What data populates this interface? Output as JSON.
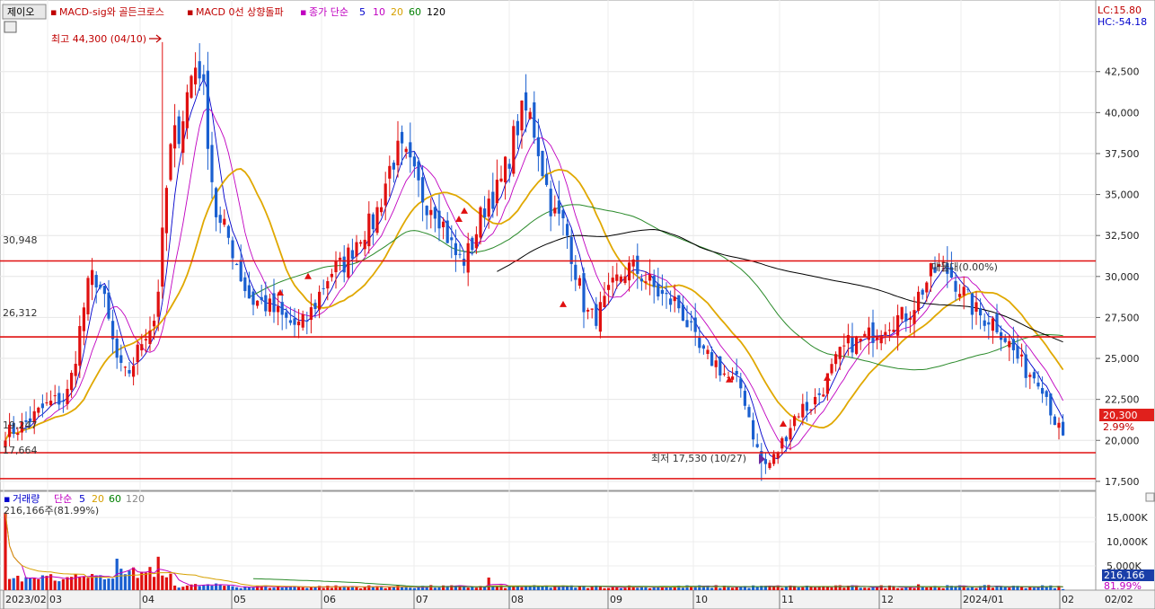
{
  "header": {
    "stock_name": "제이오",
    "indicators": [
      {
        "label": "MACD-sig와 골든크로스",
        "color": "#c00000"
      },
      {
        "label": "MACD 0선 상향돌파",
        "color": "#c00000"
      },
      {
        "label": "종가 단순",
        "color": "#c000c0"
      }
    ],
    "ma_periods": [
      {
        "label": "5",
        "color": "#0000cc"
      },
      {
        "label": "10",
        "color": "#c000c0"
      },
      {
        "label": "20",
        "color": "#d6a000"
      },
      {
        "label": "60",
        "color": "#008000"
      },
      {
        "label": "120",
        "color": "#000000"
      }
    ],
    "lc": "LC:15.80",
    "hc": "HC:-54.18"
  },
  "price_panel": {
    "high_label": "최고 44,300 (04/10)",
    "low_label": "최저 17,530 (10/27)",
    "ma_note": "매물대(0.00%)",
    "current_price": "20,300",
    "current_pct": "2.99%",
    "horizontal_lines": [
      {
        "label": "30,948",
        "value": 30948
      },
      {
        "label": "26,312",
        "value": 26312
      },
      {
        "label": "19,247",
        "value": 19247
      },
      {
        "label": "17,664",
        "value": 17664
      }
    ]
  },
  "volume_panel": {
    "title": "거래량",
    "ma_label": "단순",
    "ma_periods": [
      {
        "label": "5",
        "color": "#0000cc"
      },
      {
        "label": "20",
        "color": "#d6a000"
      },
      {
        "label": "60",
        "color": "#008000"
      },
      {
        "label": "120",
        "color": "#888888"
      }
    ],
    "current_volume": "216,166주(81.99%)",
    "current_tag": "216,166",
    "current_pct": "81.99%",
    "axis_labels": [
      "15,000K",
      "10,000K",
      "5,000K"
    ]
  },
  "x_axis": {
    "labels": [
      "2023/02",
      "03",
      "04",
      "05",
      "06",
      "07",
      "08",
      "09",
      "10",
      "11",
      "12",
      "2024/01",
      "02"
    ],
    "corner_label": "02/02"
  },
  "chart_data": [
    {
      "type": "candlestick",
      "title": "제이오",
      "y_ticks": [
        "42,500",
        "40,000",
        "37,500",
        "35,000",
        "32,500",
        "30,000",
        "27,500",
        "25,000",
        "22,500",
        "20,000",
        "17,500"
      ],
      "ylim": [
        17000,
        45500
      ],
      "months": [
        "2023/02",
        "03",
        "04",
        "05",
        "06",
        "07",
        "08",
        "09",
        "10",
        "11",
        "12",
        "2024/01",
        "02"
      ],
      "anchors": [
        {
          "month": "2023/02",
          "price": 20500
        },
        {
          "month": "03",
          "price": 22500
        },
        {
          "month": "03",
          "price": 30000
        },
        {
          "month": "03",
          "price": 24000
        },
        {
          "month": "04",
          "price": 27000
        },
        {
          "month": "04",
          "price": 38500
        },
        {
          "month": "04",
          "price": 43000
        },
        {
          "month": "04",
          "price": 33000
        },
        {
          "month": "05",
          "price": 28500
        },
        {
          "month": "05",
          "price": 27000
        },
        {
          "month": "06",
          "price": 30500
        },
        {
          "month": "06",
          "price": 33000
        },
        {
          "month": "06",
          "price": 37500
        },
        {
          "month": "07",
          "price": 34500
        },
        {
          "month": "07",
          "price": 31000
        },
        {
          "month": "07",
          "price": 35000
        },
        {
          "month": "08",
          "price": 40000
        },
        {
          "month": "08",
          "price": 33500
        },
        {
          "month": "08",
          "price": 27500
        },
        {
          "month": "09",
          "price": 30500
        },
        {
          "month": "09",
          "price": 28500
        },
        {
          "month": "10",
          "price": 25000
        },
        {
          "month": "10",
          "price": 23500
        },
        {
          "month": "10",
          "price": 18500
        },
        {
          "month": "11",
          "price": 22000
        },
        {
          "month": "11",
          "price": 26000
        },
        {
          "month": "12",
          "price": 27500
        },
        {
          "month": "12",
          "price": 30500
        },
        {
          "month": "2024/01",
          "price": 27500
        },
        {
          "month": "2024/01",
          "price": 24000
        },
        {
          "month": "02",
          "price": 20300
        }
      ],
      "high": 44300,
      "low": 17530,
      "last": 20300
    },
    {
      "type": "bar",
      "title": "거래량",
      "ylim": [
        0,
        18000
      ],
      "unit": "K",
      "spikes": [
        {
          "month": "2023/02",
          "value": 16000
        },
        {
          "month": "03",
          "value": 3300
        },
        {
          "month": "04",
          "value": 6500
        },
        {
          "month": "04",
          "value": 6900
        },
        {
          "month": "08",
          "value": 2600
        },
        {
          "month": "12",
          "value": 1200
        },
        {
          "month": "02",
          "value": 216
        }
      ]
    }
  ]
}
